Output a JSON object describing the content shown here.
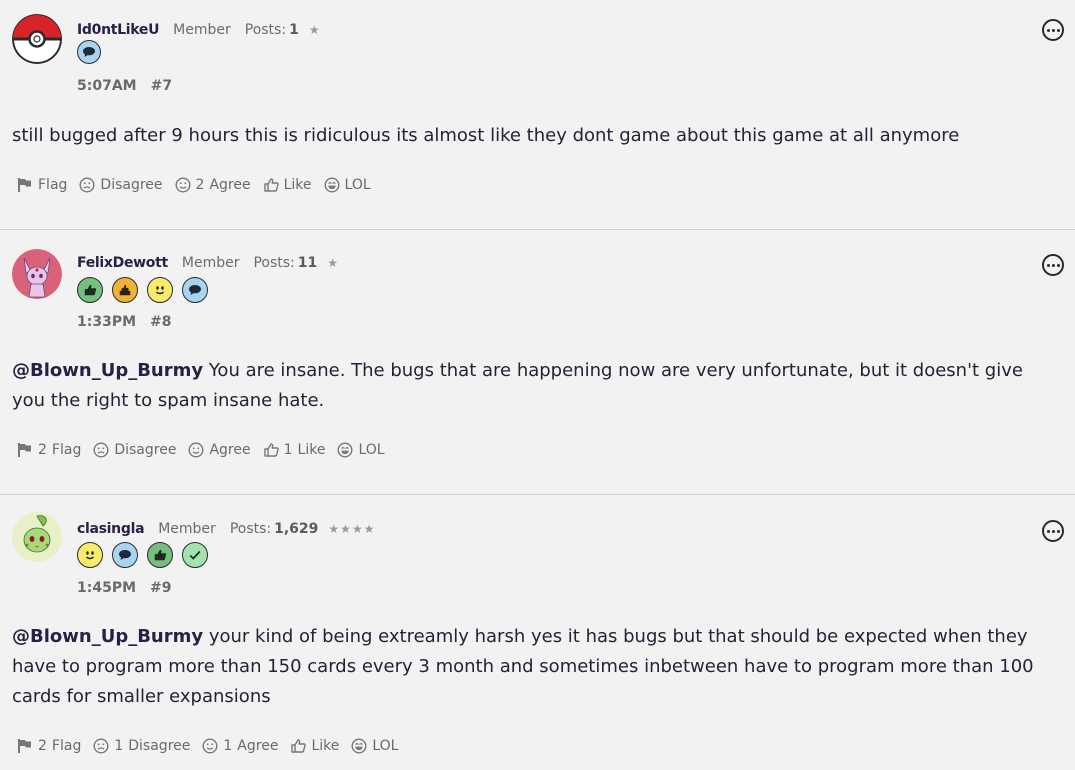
{
  "posts": [
    {
      "author": "Id0ntLikeU",
      "rank": "Member",
      "posts_label": "Posts:",
      "posts_count": "1",
      "stars": "★",
      "time": "5:07AM",
      "number": "#7",
      "mention": "",
      "body": "still bugged after 9 hours this is ridiculous its almost like they dont game about this game at all anymore",
      "reactions": {
        "flag": {
          "count": "",
          "label": "Flag"
        },
        "disagree": {
          "count": "",
          "label": "Disagree"
        },
        "agree": {
          "count": "2",
          "label": "Agree"
        },
        "like": {
          "count": "",
          "label": "Like"
        },
        "lol": {
          "count": "",
          "label": "LOL"
        }
      }
    },
    {
      "author": "FelixDewott",
      "rank": "Member",
      "posts_label": "Posts:",
      "posts_count": "11",
      "stars": "★",
      "time": "1:33PM",
      "number": "#8",
      "mention": "@Blown_Up_Burmy",
      "body": " You are insane. The bugs that are happening now are very unfortunate, but it doesn't give you the right to spam insane hate.",
      "reactions": {
        "flag": {
          "count": "2",
          "label": "Flag"
        },
        "disagree": {
          "count": "",
          "label": "Disagree"
        },
        "agree": {
          "count": "",
          "label": "Agree"
        },
        "like": {
          "count": "1",
          "label": "Like"
        },
        "lol": {
          "count": "",
          "label": "LOL"
        }
      }
    },
    {
      "author": "clasingla",
      "rank": "Member",
      "posts_label": "Posts:",
      "posts_count": "1,629",
      "stars": "★★★★",
      "time": "1:45PM",
      "number": "#9",
      "mention": "@Blown_Up_Burmy",
      "body": " your kind of being extreamly harsh yes it has bugs but that should be expected when they have to program more than 150 cards every 3 month and sometimes inbetween have to program more than 100 cards for smaller expansions",
      "reactions": {
        "flag": {
          "count": "2",
          "label": "Flag"
        },
        "disagree": {
          "count": "1",
          "label": "Disagree"
        },
        "agree": {
          "count": "1",
          "label": "Agree"
        },
        "like": {
          "count": "",
          "label": "Like"
        },
        "lol": {
          "count": "",
          "label": "LOL"
        }
      }
    }
  ],
  "icons": {
    "menu": "ellipsis-circle-icon",
    "flag": "flag-icon",
    "disagree": "frown-face-icon",
    "agree": "smile-face-icon",
    "like": "thumbs-up-icon",
    "lol": "laugh-face-icon"
  },
  "colors": {
    "background": "#f2f2f2",
    "text": "#2a2036",
    "muted": "#6a6a6a",
    "divider": "#cfcfcf"
  }
}
